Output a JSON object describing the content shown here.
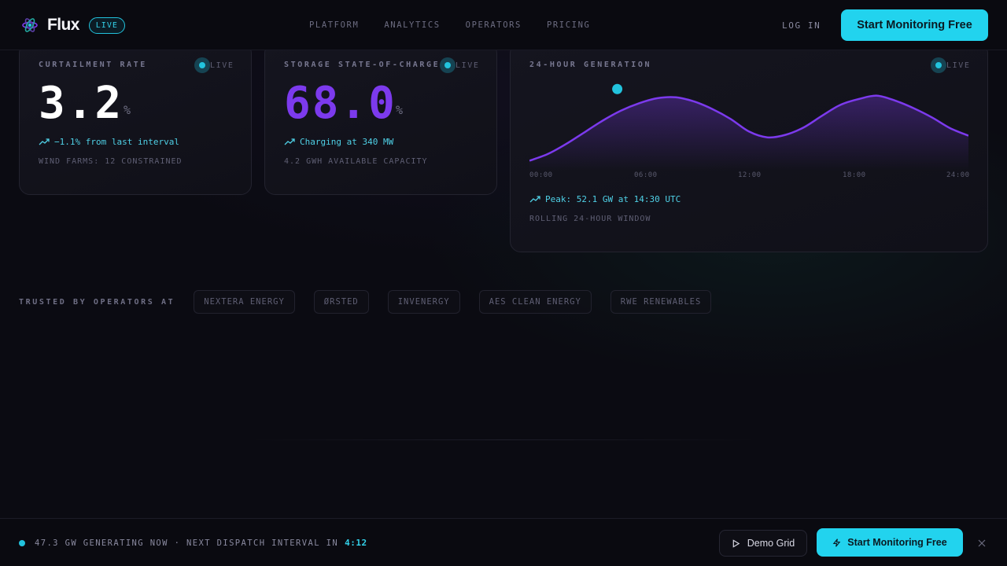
{
  "header": {
    "brand_name": "Flux",
    "live_badge": "LIVE",
    "nav": [
      "PLATFORM",
      "ANALYTICS",
      "OPERATORS",
      "PRICING"
    ],
    "login_label": "LOG IN",
    "cta_label": "Start Monitoring Free",
    "accent_color": "#22d3ee"
  },
  "cards": {
    "curtailment": {
      "label": "CURTAILMENT RATE",
      "live": "LIVE",
      "value": "3.2",
      "unit": "%",
      "delta": "−1.1% from last interval",
      "footnote": "WIND FARMS: 12 CONSTRAINED",
      "value_color": "#ffffff"
    },
    "storage": {
      "label": "STORAGE STATE-OF-CHARGE",
      "live": "LIVE",
      "value": "68.0",
      "unit": "%",
      "delta": "Charging at 340 MW",
      "footnote": "4.2 GWH AVAILABLE CAPACITY",
      "value_color": "#7c3aed"
    },
    "generation": {
      "label": "24-HOUR GENERATION",
      "live": "LIVE",
      "peak_note": "Peak: 52.1 GW at 14:30 UTC",
      "footnote": "ROLLING 24-HOUR WINDOW",
      "ticks": [
        "00:00",
        "06:00",
        "12:00",
        "18:00",
        "24:00"
      ],
      "line_color": "#7c3aed"
    }
  },
  "chart_data": {
    "type": "area",
    "title": "24-HOUR GENERATION",
    "xlabel": "",
    "ylabel": "",
    "x_ticks": [
      "00:00",
      "06:00",
      "12:00",
      "18:00",
      "24:00"
    ],
    "x": [
      0,
      1,
      2,
      3,
      4,
      5,
      6,
      7,
      8,
      9,
      10,
      11,
      12,
      13,
      14,
      15,
      16,
      17,
      18,
      19,
      20,
      21,
      22,
      23,
      24
    ],
    "values": [
      10,
      18,
      30,
      44,
      58,
      70,
      79,
      85,
      86,
      81,
      72,
      60,
      45,
      38,
      41,
      50,
      64,
      77,
      84,
      88,
      82,
      73,
      62,
      49,
      40
    ],
    "ylim": [
      0,
      100
    ],
    "marker": {
      "x": 4.8,
      "y": 96
    },
    "grid": false,
    "legend": "none"
  },
  "trusted": {
    "label": "TRUSTED BY OPERATORS AT",
    "partners": [
      "NEXTERA ENERGY",
      "ØRSTED",
      "INVENERGY",
      "AES CLEAN ENERGY",
      "RWE RENEWABLES"
    ]
  },
  "bottom_bar": {
    "status_text": "47.3 GW GENERATING NOW · NEXT DISPATCH INTERVAL IN",
    "countdown": "4:12",
    "demo_label": "Demo Grid",
    "cta_label": "Start Monitoring Free"
  }
}
